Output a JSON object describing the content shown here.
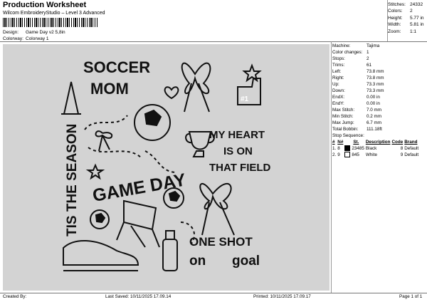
{
  "header": {
    "title": "Production Worksheet",
    "software": "Wilcom EmbroideryStudio – Level 3 Advanced",
    "design_label": "Design:",
    "design_value": "Game Day v2 5,8in",
    "colorway_label": "Colorway:",
    "colorway_value": "Colorway 1"
  },
  "summary": [
    {
      "label": "Stitches:",
      "value": "24332"
    },
    {
      "label": "Colors:",
      "value": "2"
    },
    {
      "label": "Height:",
      "value": "5.77 in"
    },
    {
      "label": "Width:",
      "value": "5.81 in"
    },
    {
      "label": "Zoom:",
      "value": "1:1"
    }
  ],
  "properties": [
    {
      "label": "Machine:",
      "value": "Tajima"
    },
    {
      "label": "Color changes:",
      "value": "1"
    },
    {
      "label": "Stops:",
      "value": "2"
    },
    {
      "label": "Trims:",
      "value": "61"
    },
    {
      "label": "Left:",
      "value": "73.8 mm"
    },
    {
      "label": "Right:",
      "value": "73.8 mm"
    },
    {
      "label": "Up:",
      "value": "73.3 mm"
    },
    {
      "label": "Down:",
      "value": "73.3 mm"
    },
    {
      "label": "EndX:",
      "value": "0.00 in"
    },
    {
      "label": "EndY:",
      "value": "0.00 in"
    },
    {
      "label": "Max Stitch:",
      "value": "7.0 mm"
    },
    {
      "label": "Min Stitch:",
      "value": "0.2 mm"
    },
    {
      "label": "Max Jump:",
      "value": "6.7 mm"
    },
    {
      "label": "Total Bobbin:",
      "value": "111.18ft"
    }
  ],
  "stop_sequence": {
    "title": "Stop Sequence:",
    "columns": [
      "#",
      "N#",
      "St.",
      "Description",
      "Code",
      "Brand"
    ],
    "rows": [
      {
        "num": "1.",
        "needle": "8",
        "swatch": "#000000",
        "stitches": "23485",
        "description": "Black",
        "code": "8",
        "brand": "Default"
      },
      {
        "num": "2.",
        "needle": "9",
        "swatch": "#ffffff",
        "stitches": "845",
        "description": "White",
        "code": "9",
        "brand": "Default"
      }
    ]
  },
  "design_text": {
    "soccer": "SOCCER",
    "mom": "MOM",
    "tis_the_season": "TIS THE SEASON",
    "my_heart": "MY HEART",
    "is_on": "IS ON",
    "that_field": "THAT FIELD",
    "game_day": "GAME DAY",
    "one_shot": "ONE SHOT",
    "on": "on",
    "goal": "goal",
    "finger_number": "#1"
  },
  "footer": {
    "created_by": "Created By:",
    "last_saved": "Last Saved: 10/11/2025 17.09.14",
    "printed": "Printed: 10/11/2025 17.09.17",
    "page": "Page 1 of 1"
  }
}
